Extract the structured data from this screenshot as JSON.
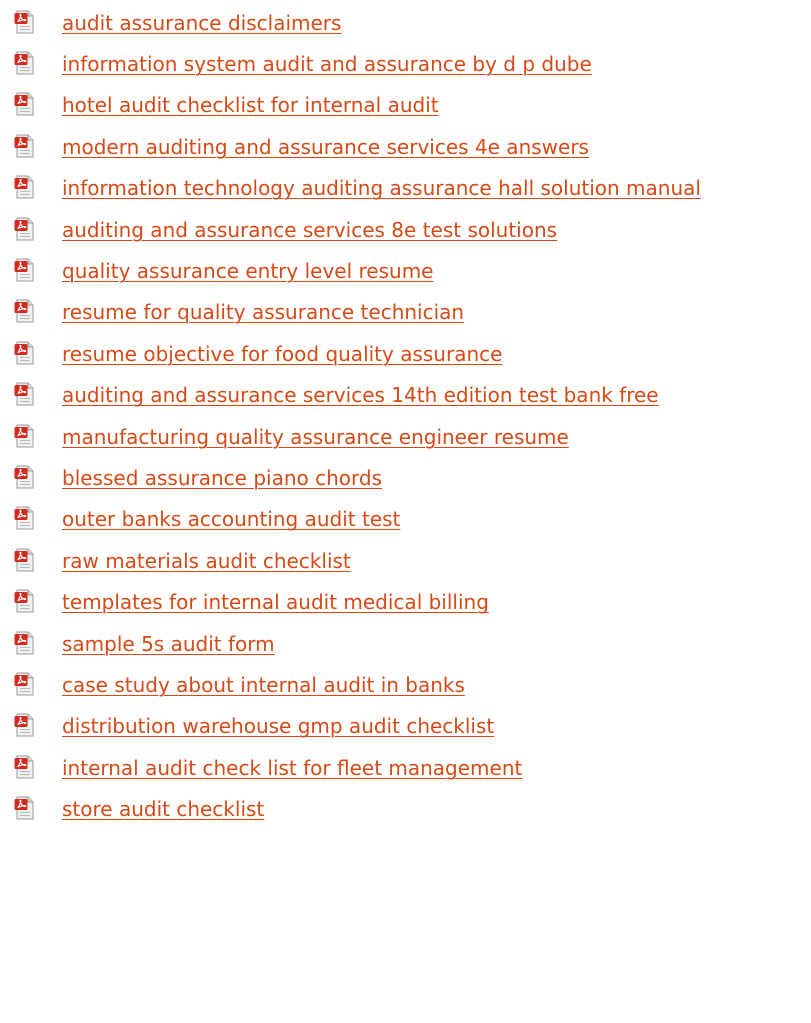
{
  "colors": {
    "link": "#d64a17",
    "icon_red": "#d42a1e",
    "icon_page": "#f1f1f1",
    "icon_border": "#9a9a9a"
  },
  "icon": "pdf-file-icon",
  "links": [
    {
      "label": "audit assurance disclaimers"
    },
    {
      "label": "information system audit and assurance by d p dube"
    },
    {
      "label": "hotel audit checklist for internal audit"
    },
    {
      "label": "modern auditing and assurance services 4e answers"
    },
    {
      "label": "information technology auditing assurance hall solution manual"
    },
    {
      "label": "auditing and assurance services 8e test solutions"
    },
    {
      "label": "quality assurance entry level resume"
    },
    {
      "label": "resume for quality assurance technician"
    },
    {
      "label": "resume objective for food quality assurance"
    },
    {
      "label": "auditing and assurance services 14th edition test bank free"
    },
    {
      "label": "manufacturing quality assurance engineer resume"
    },
    {
      "label": "blessed assurance piano chords"
    },
    {
      "label": "outer banks accounting audit test"
    },
    {
      "label": "raw materials audit checklist"
    },
    {
      "label": "templates for internal audit medical billing"
    },
    {
      "label": "sample 5s audit form"
    },
    {
      "label": "case study about internal audit in banks"
    },
    {
      "label": "distribution warehouse gmp audit checklist"
    },
    {
      "label": "internal audit check list for fleet management"
    },
    {
      "label": "store audit checklist"
    }
  ]
}
